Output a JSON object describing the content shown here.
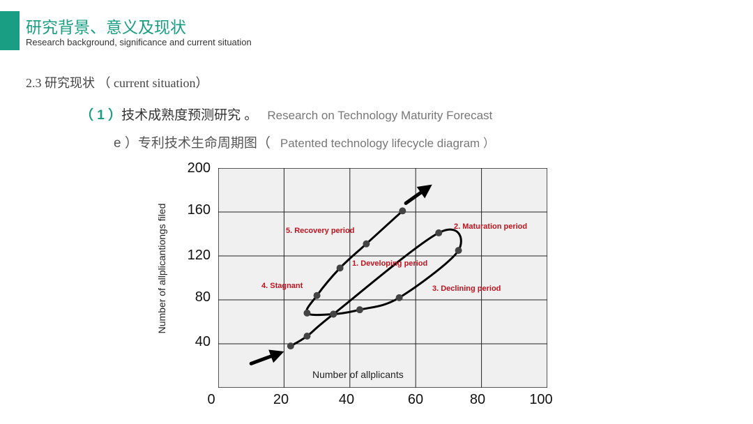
{
  "header": {
    "title": "研究背景、意义及现状",
    "subtitle": "Research background, significance and current situation",
    "accent": "#1a9e83"
  },
  "section": "2.3 研究现状 （ current situation）",
  "item1": {
    "num": "（ 1 ）",
    "cn": "技术成熟度预测研究 。",
    "en": "Research on Technology Maturity Forecast"
  },
  "item2": {
    "cn": "e ）专利技术生命周期图（",
    "en": "Patented technology lifecycle diagram ）"
  },
  "chart_data": {
    "type": "line",
    "xlabel": "Number of allplicants",
    "ylabel": "Number of allplicantiongs filed",
    "xlim": [
      0,
      100
    ],
    "ylim": [
      0,
      200
    ],
    "xticks": [
      "0",
      "20",
      "40",
      "60",
      "80",
      "100"
    ],
    "yticks": [
      "200",
      "160",
      "120",
      "80",
      "40"
    ],
    "grid": true,
    "background": "#f0f0f0",
    "annotation_color": "#c0141e",
    "points": [
      [
        22,
        38
      ],
      [
        27,
        47
      ],
      [
        35,
        67
      ],
      [
        67,
        141
      ],
      [
        73,
        125
      ],
      [
        55,
        82
      ],
      [
        43,
        71
      ],
      [
        35,
        67
      ],
      [
        27,
        68
      ],
      [
        30,
        84
      ],
      [
        37,
        109
      ],
      [
        45,
        131
      ],
      [
        56,
        161
      ]
    ],
    "arrows": [
      {
        "from": [
          10,
          22
        ],
        "to": [
          20,
          33
        ]
      },
      {
        "from": [
          57,
          168
        ],
        "to": [
          65,
          185
        ]
      }
    ],
    "annotations": [
      "1. Developing period",
      "2. Maturation period",
      "3. Declining period",
      "4. Stagnant",
      "5. Recovery period"
    ]
  }
}
